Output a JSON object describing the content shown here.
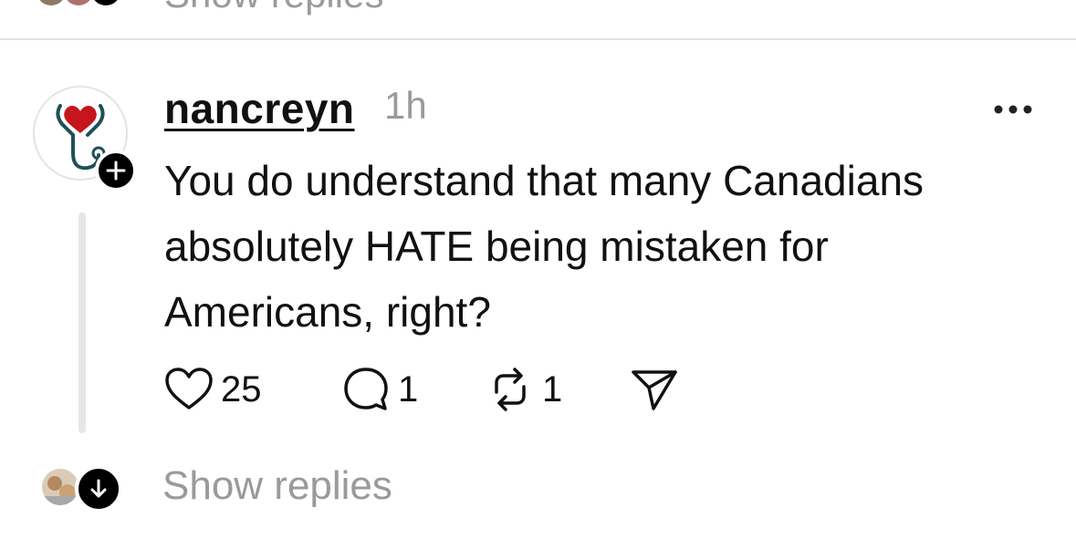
{
  "previous_post": {
    "show_replies_label": "Show replies"
  },
  "post": {
    "username": "nancreyn",
    "timestamp": "1h",
    "text": "You do understand that many Canadians absolutely HATE being mistaken for Americans, right?",
    "likes": "25",
    "comments": "1",
    "reposts": "1"
  },
  "replies": {
    "show_replies_label": "Show replies"
  },
  "icons": {
    "more": "more-horizontal-icon",
    "like": "heart-icon",
    "comment": "comment-bubble-icon",
    "repost": "repost-icon",
    "share": "send-icon",
    "follow": "plus-icon",
    "expand": "arrow-down-icon"
  },
  "colors": {
    "text": "#111111",
    "muted": "#9a9a9a",
    "divider": "#e3e3e3",
    "thread_line": "#e6e6e6",
    "heart_red": "#c4161c",
    "stethoscope_teal": "#1f4f57"
  }
}
